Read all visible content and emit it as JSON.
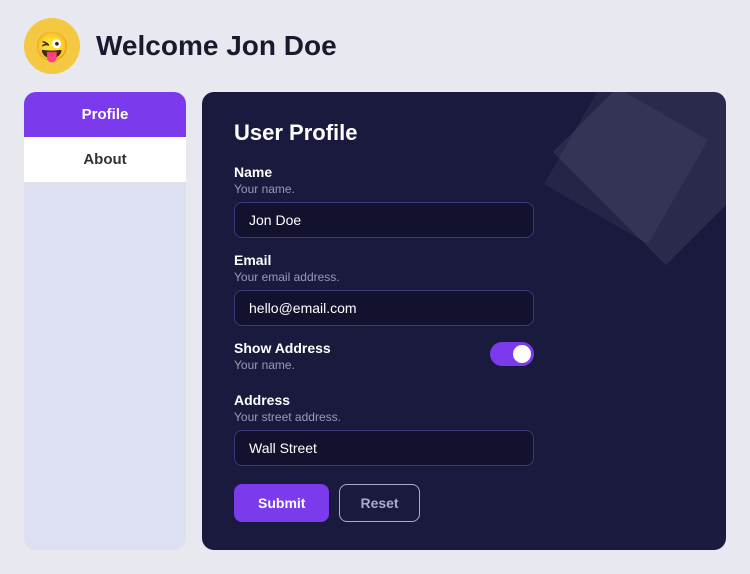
{
  "header": {
    "title": "Welcome Jon Doe",
    "avatar_emoji": "😜"
  },
  "sidebar": {
    "items": [
      {
        "id": "profile",
        "label": "Profile",
        "active": true
      },
      {
        "id": "about",
        "label": "About",
        "active": false
      }
    ]
  },
  "card": {
    "title": "User Profile",
    "fields": {
      "name": {
        "label": "Name",
        "sublabel": "Your name.",
        "value": "Jon Doe",
        "placeholder": "Jon Doe"
      },
      "email": {
        "label": "Email",
        "sublabel": "Your email address.",
        "value": "hello@email.com",
        "placeholder": "hello@email.com"
      },
      "show_address": {
        "label": "Show Address",
        "sublabel": "Your name.",
        "enabled": true
      },
      "address": {
        "label": "Address",
        "sublabel": "Your street address.",
        "value": "Wall Street",
        "placeholder": "Wall Street"
      }
    },
    "buttons": {
      "submit": "Submit",
      "reset": "Reset"
    }
  }
}
